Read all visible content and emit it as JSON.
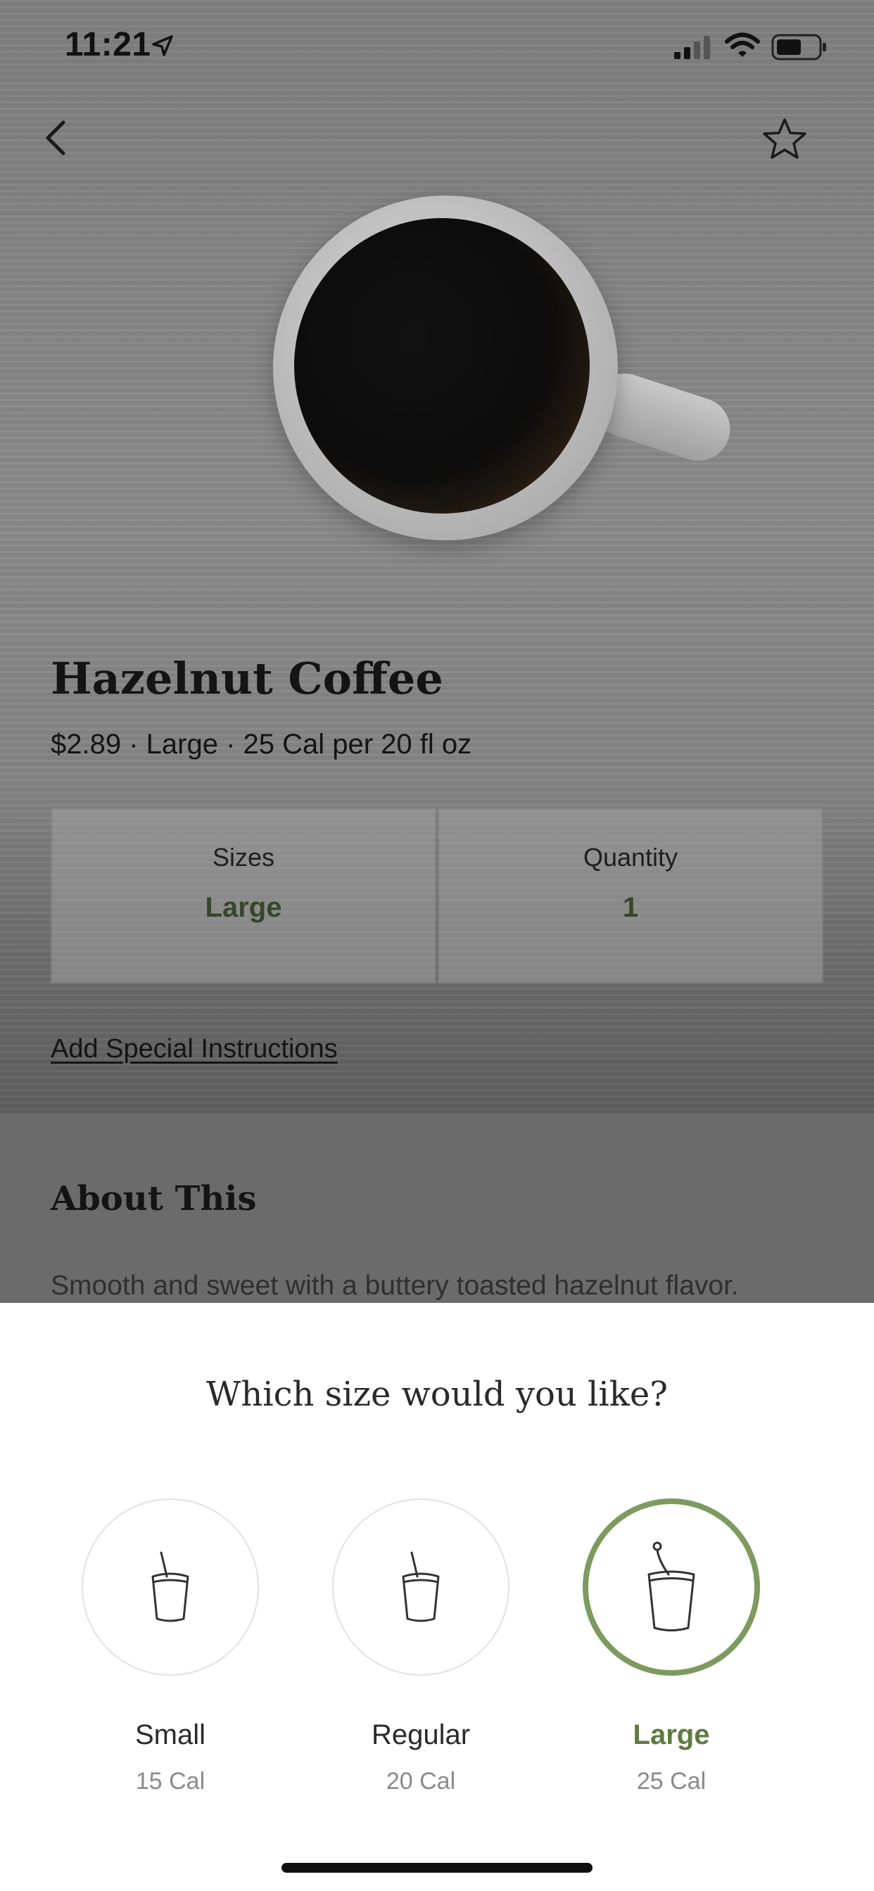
{
  "status_bar": {
    "time": "11:21"
  },
  "product": {
    "title": "Hazelnut Coffee",
    "subtitle": "$2.89 · Large · 25 Cal per 20 fl oz",
    "sizes_label": "Sizes",
    "sizes_value": "Large",
    "quantity_label": "Quantity",
    "quantity_value": "1",
    "special_instructions": "Add Special Instructions",
    "about_title": "About This",
    "about_description": "Smooth and sweet with a buttery toasted hazelnut flavor."
  },
  "size_sheet": {
    "title": "Which size would you like?",
    "options": [
      {
        "name": "Small",
        "calories": "15 Cal",
        "selected": false
      },
      {
        "name": "Regular",
        "calories": "20 Cal",
        "selected": false
      },
      {
        "name": "Large",
        "calories": "25 Cal",
        "selected": true
      }
    ]
  },
  "colors": {
    "accent_green": "#7d9a5f",
    "selected_text": "#5e7a3e"
  },
  "icons": [
    "back-icon",
    "star-icon",
    "location-arrow-icon",
    "signal-icon",
    "wifi-icon",
    "battery-icon",
    "cup-icon"
  ]
}
